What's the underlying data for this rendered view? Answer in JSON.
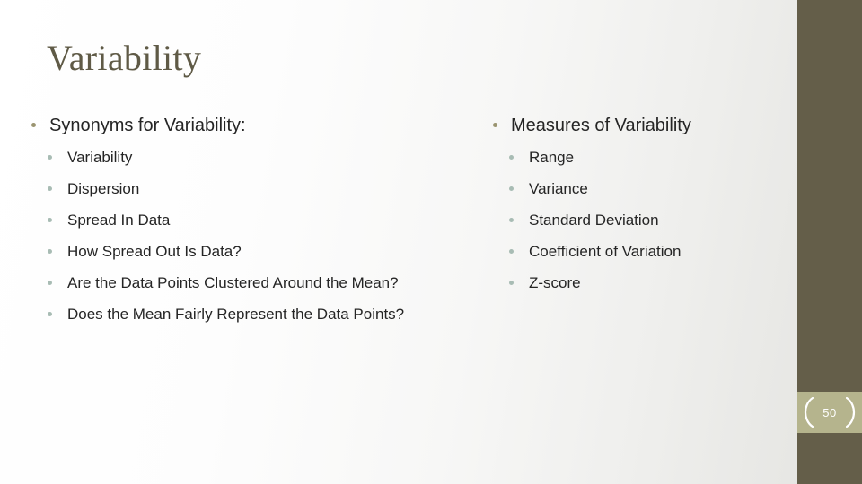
{
  "slide": {
    "title": "Variability",
    "number": "50",
    "accent_dark": "#645E49",
    "accent_light": "#B5B48D",
    "title_color": "#5F5A46",
    "bullet_level1_color": "#9A9470",
    "bullet_level2_color": "#A8BCB4",
    "body_text_color": "#252525"
  },
  "columns": {
    "left": {
      "heading": "Synonyms for Variability:",
      "items": [
        "Variability",
        "Dispersion",
        "Spread In Data",
        "How Spread Out Is Data?",
        "Are the Data Points Clustered Around the Mean?",
        "Does the Mean Fairly Represent the Data Points?"
      ]
    },
    "right": {
      "heading": "Measures of Variability",
      "items": [
        "Range",
        "Variance",
        "Standard Deviation",
        "Coefficient of Variation",
        "Z-score"
      ]
    }
  }
}
